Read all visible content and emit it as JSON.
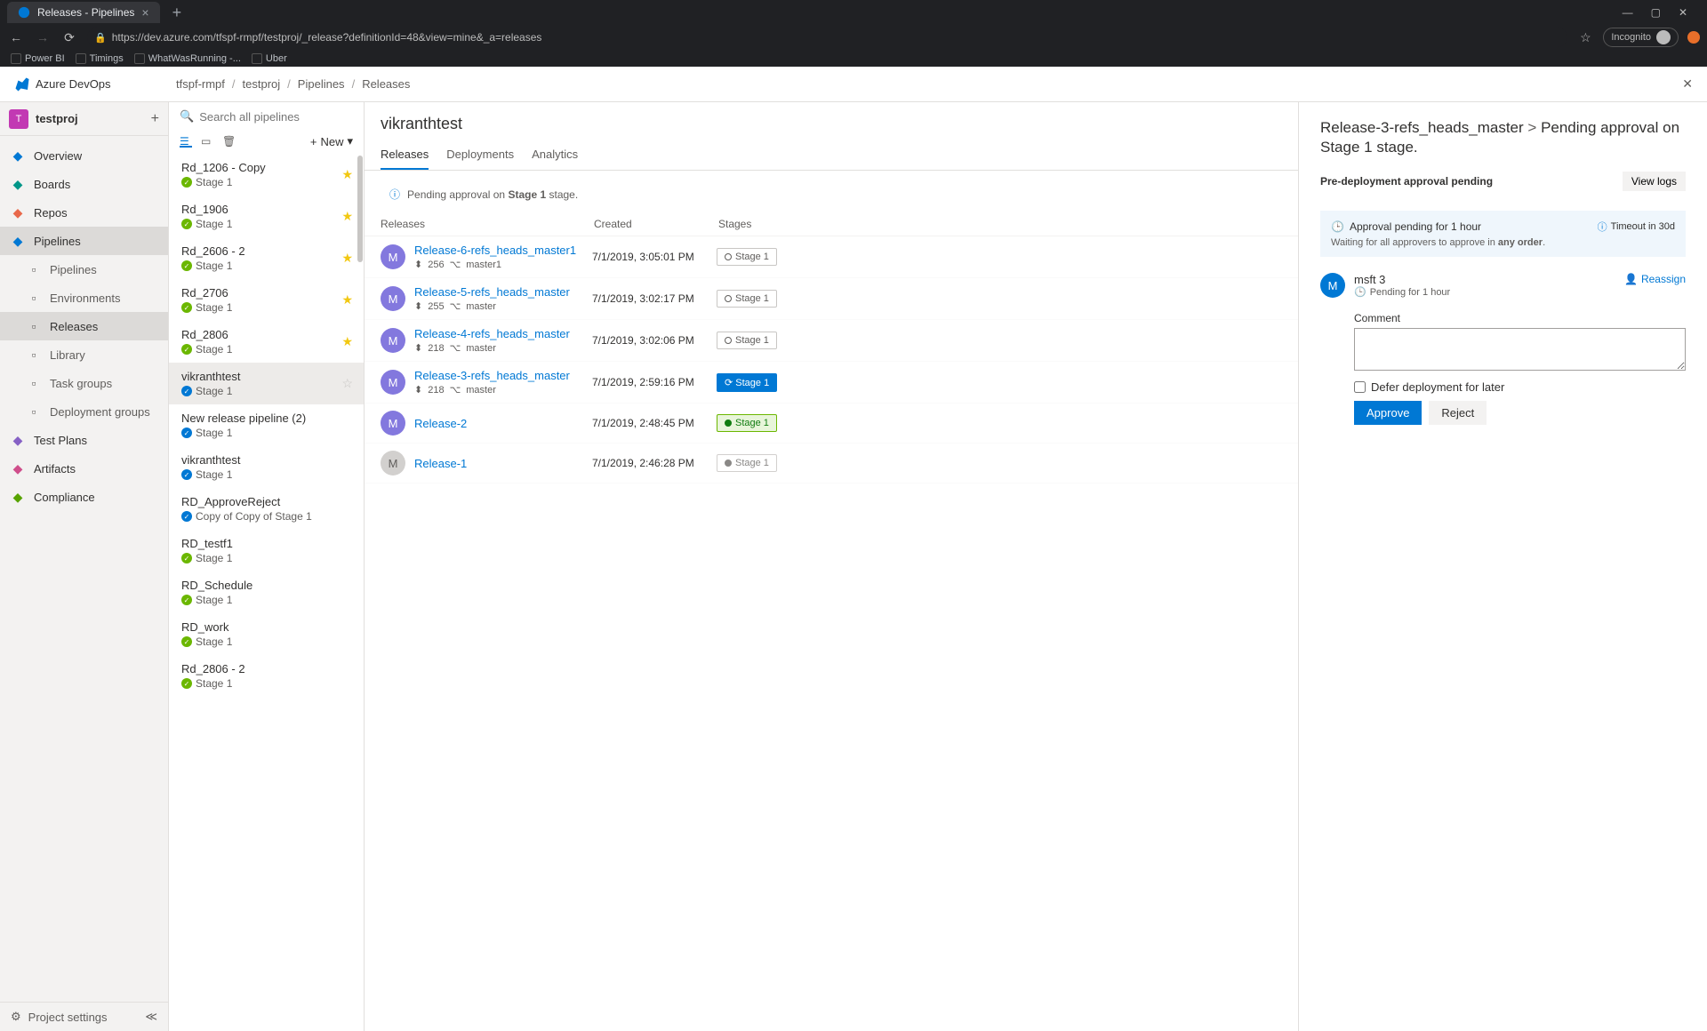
{
  "browser": {
    "tab_title": "Releases - Pipelines",
    "url": "https://dev.azure.com/tfspf-rmpf/testproj/_release?definitionId=48&view=mine&_a=releases",
    "incognito": "Incognito",
    "bookmarks": [
      "Power BI",
      "Timings",
      "WhatWasRunning -...",
      "Uber"
    ]
  },
  "brand": "Azure DevOps",
  "breadcrumb": [
    "tfspf-rmpf",
    "testproj",
    "Pipelines",
    "Releases"
  ],
  "project": {
    "initial": "T",
    "name": "testproj"
  },
  "nav": {
    "items": [
      {
        "icon": "grid",
        "label": "Overview",
        "color": "#0078d4"
      },
      {
        "icon": "board",
        "label": "Boards",
        "color": "#009688"
      },
      {
        "icon": "repo",
        "label": "Repos",
        "color": "#e8684a"
      },
      {
        "icon": "rocket",
        "label": "Pipelines",
        "color": "#0078d4",
        "active": true,
        "sub": [
          {
            "label": "Pipelines"
          },
          {
            "label": "Environments"
          },
          {
            "label": "Releases",
            "active": true
          },
          {
            "label": "Library"
          },
          {
            "label": "Task groups"
          },
          {
            "label": "Deployment groups"
          }
        ]
      },
      {
        "icon": "flask",
        "label": "Test Plans",
        "color": "#8661c5"
      },
      {
        "icon": "package",
        "label": "Artifacts",
        "color": "#cf4e8b"
      },
      {
        "icon": "shield",
        "label": "Compliance",
        "color": "#57a300"
      }
    ],
    "settings": "Project settings"
  },
  "search_placeholder": "Search all pipelines",
  "new_btn": "New",
  "pipelines": [
    {
      "name": "Rd_1206 - Copy",
      "stage": "Stage 1",
      "status": "green",
      "starred": true
    },
    {
      "name": "Rd_1906",
      "stage": "Stage 1",
      "status": "green",
      "starred": true
    },
    {
      "name": "Rd_2606 - 2",
      "stage": "Stage 1",
      "status": "green",
      "starred": true
    },
    {
      "name": "Rd_2706",
      "stage": "Stage 1",
      "status": "green",
      "starred": true
    },
    {
      "name": "Rd_2806",
      "stage": "Stage 1",
      "status": "green",
      "starred": true
    },
    {
      "name": "vikranthtest",
      "stage": "Stage 1",
      "status": "blue",
      "starred": false,
      "active": true
    },
    {
      "name": "New release pipeline (2)",
      "stage": "Stage 1",
      "status": "blue"
    },
    {
      "name": "vikranthtest",
      "stage": "Stage 1",
      "status": "blue"
    },
    {
      "name": "RD_ApproveReject",
      "stage": "Copy of Copy of Stage 1",
      "status": "blue"
    },
    {
      "name": "RD_testf1",
      "stage": "Stage 1",
      "status": "green"
    },
    {
      "name": "RD_Schedule",
      "stage": "Stage 1",
      "status": "green"
    },
    {
      "name": "RD_work",
      "stage": "Stage 1",
      "status": "green"
    },
    {
      "name": "Rd_2806 - 2",
      "stage": "Stage 1",
      "status": "green"
    }
  ],
  "main": {
    "title": "vikranthtest",
    "tabs": [
      "Releases",
      "Deployments",
      "Analytics"
    ],
    "info_prefix": "Pending approval on",
    "info_bold": "Stage 1",
    "info_suffix": "stage.",
    "columns": {
      "releases": "Releases",
      "created": "Created",
      "stages": "Stages"
    },
    "releases": [
      {
        "name": "Release-6-refs_heads_master1",
        "build": "256",
        "branch": "master1",
        "created": "7/1/2019, 3:05:01 PM",
        "stage": "Stage 1",
        "state": "pending"
      },
      {
        "name": "Release-5-refs_heads_master",
        "build": "255",
        "branch": "master",
        "created": "7/1/2019, 3:02:17 PM",
        "stage": "Stage 1",
        "state": "pending"
      },
      {
        "name": "Release-4-refs_heads_master",
        "build": "218",
        "branch": "master",
        "created": "7/1/2019, 3:02:06 PM",
        "stage": "Stage 1",
        "state": "pending"
      },
      {
        "name": "Release-3-refs_heads_master",
        "build": "218",
        "branch": "master",
        "created": "7/1/2019, 2:59:16 PM",
        "stage": "Stage 1",
        "state": "active"
      },
      {
        "name": "Release-2",
        "created": "7/1/2019, 2:48:45 PM",
        "stage": "Stage 1",
        "state": "success"
      },
      {
        "name": "Release-1",
        "created": "7/1/2019, 2:46:28 PM",
        "stage": "Stage 1",
        "state": "done-gray",
        "gray": true
      }
    ]
  },
  "approval": {
    "title_release": "Release-3-refs_heads_master",
    "title_stage": "Pending approval on Stage 1 stage.",
    "subtitle": "Pre-deployment approval pending",
    "view_logs": "View logs",
    "pending_text": "Approval pending for 1 hour",
    "waiting_text": "Waiting for all approvers to approve in",
    "waiting_bold": "any order",
    "timeout": "Timeout in 30d",
    "user": {
      "initial": "M",
      "name": "msft 3",
      "status": "Pending for 1 hour"
    },
    "reassign": "Reassign",
    "comment_label": "Comment",
    "defer_label": "Defer deployment for later",
    "approve": "Approve",
    "reject": "Reject"
  }
}
